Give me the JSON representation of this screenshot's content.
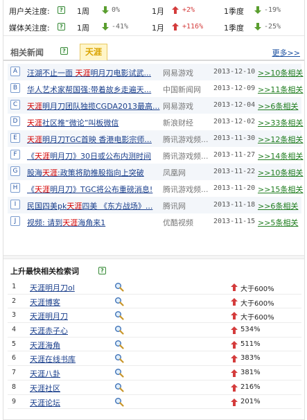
{
  "attention": {
    "rows": [
      {
        "label": "用户关注度:",
        "items": [
          {
            "period": "1周",
            "direction": "down",
            "value": "0%"
          },
          {
            "period": "1月",
            "direction": "up",
            "value": "+2%"
          },
          {
            "period": "1季度",
            "direction": "down",
            "value": "-19%"
          }
        ]
      },
      {
        "label": "媒体关注度:",
        "items": [
          {
            "period": "1周",
            "direction": "down",
            "value": "-41%"
          },
          {
            "period": "1月",
            "direction": "up",
            "value": "+116%"
          },
          {
            "period": "1季度",
            "direction": "down",
            "value": "-25%"
          }
        ]
      }
    ]
  },
  "news": {
    "title": "相关新闻",
    "tag": "天涯",
    "more": "更多>>",
    "keyword": "天涯",
    "items": [
      {
        "letter": "A",
        "title": "汪湖不止一面 天涯明月刀电影试武...",
        "source": "网易游戏",
        "date": "2013-12-10",
        "related": ">>10条相关"
      },
      {
        "letter": "B",
        "title": "华人艺术家帮国强:带着故乡走遍天...",
        "source": "中国新闻网",
        "date": "2013-12-09",
        "related": ">>11条相关"
      },
      {
        "letter": "C",
        "title": "天涯明月刀团队独揽CGDA2013最高...",
        "source": "网易游戏",
        "date": "2013-12-04",
        "related": ">>6条相关"
      },
      {
        "letter": "D",
        "title": "天涯社区推“微论”叫板微信",
        "source": "新浪财经",
        "date": "2013-12-02",
        "related": ">>33条相关"
      },
      {
        "letter": "E",
        "title": "天涯明月刀TGC首映 香港电影宗师...",
        "source": "腾讯游戏频...",
        "date": "2013-11-30",
        "related": ">>12条相关"
      },
      {
        "letter": "F",
        "title": "《天涯明月刀》30日或公布内测时间",
        "source": "腾讯游戏频...",
        "date": "2013-11-27",
        "related": ">>14条相关"
      },
      {
        "letter": "G",
        "title": "股海天涯:政策将助推股指向上突破",
        "source": "凤凰网",
        "date": "2013-11-22",
        "related": ">>10条相关"
      },
      {
        "letter": "H",
        "title": "《天涯明月刀》TGC将公布重磅消息!",
        "source": "腾讯游戏频...",
        "date": "2013-11-20",
        "related": ">>15条相关"
      },
      {
        "letter": "I",
        "title": "民国四美pk天涯四美 《东方战场》...",
        "source": "腾讯网",
        "date": "2013-11-18",
        "related": ">>6条相关"
      },
      {
        "letter": "J",
        "title": "视频: 请到天涯海角来1",
        "source": "优酷视频",
        "date": "2013-11-15",
        "related": ">>5条相关"
      }
    ]
  },
  "search_terms": {
    "title": "上升最快相关检索词",
    "items": [
      {
        "rank": "1",
        "term": "天涯明月刀ol",
        "growth": "大于600%"
      },
      {
        "rank": "2",
        "term": "天涯博客",
        "growth": "大于600%"
      },
      {
        "rank": "3",
        "term": "天涯明月刀",
        "growth": "大于600%"
      },
      {
        "rank": "4",
        "term": "天涯赤子心",
        "growth": "534%"
      },
      {
        "rank": "5",
        "term": "天涯海角",
        "growth": "511%"
      },
      {
        "rank": "6",
        "term": "天涯在线书库",
        "growth": "383%"
      },
      {
        "rank": "7",
        "term": "天涯八卦",
        "growth": "381%"
      },
      {
        "rank": "8",
        "term": "天涯社区",
        "growth": "216%"
      },
      {
        "rank": "9",
        "term": "天涯论坛",
        "growth": "201%"
      }
    ]
  },
  "icons": {
    "help": "question-icon",
    "trend_up": "red-up-arrow-icon",
    "trend_down": "green-down-arrow-icon",
    "search": "magnifier-icon"
  },
  "colors": {
    "up": "#d43c3c",
    "down": "#5a9e2f",
    "link": "#1a3f8c",
    "related": "#1f7d1f",
    "keyword": "#d40000",
    "tab_bg": "#fff5c8",
    "tab_text": "#d9a300"
  }
}
